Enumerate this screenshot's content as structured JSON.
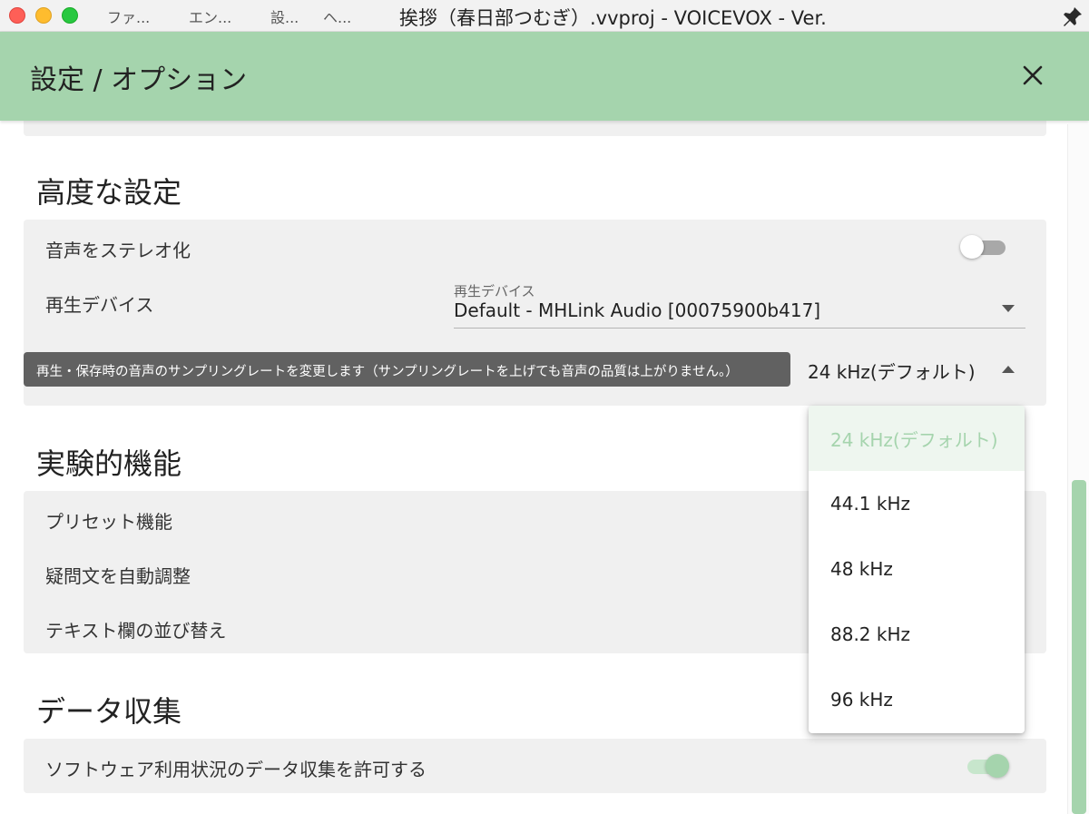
{
  "window": {
    "menus": [
      "ファ...",
      "エン...",
      "設...",
      "ヘ..."
    ],
    "title": "挨拶（春日部つむぎ）.vvproj - VOICEVOX - Ver."
  },
  "dialog": {
    "title": "設定 / オプション"
  },
  "advanced": {
    "title": "高度な設定",
    "stereo": {
      "label": "音声をステレオ化",
      "enabled": false
    },
    "device": {
      "label": "再生デバイス",
      "field_label": "再生デバイス",
      "value": "Default - MHLink Audio [00075900b417]"
    },
    "sampling": {
      "tooltip": "再生・保存時の音声のサンプリングレートを変更します（サンプリングレートを上げても音声の品質は上がりません。）",
      "value": "24 kHz(デフォルト)",
      "options": [
        "24 kHz(デフォルト)",
        "44.1 kHz",
        "48 kHz",
        "88.2 kHz",
        "96 kHz"
      ],
      "selected_index": 0
    }
  },
  "experimental": {
    "title": "実験的機能",
    "items": [
      "プリセット機能",
      "疑問文を自動調整",
      "テキスト欄の並び替え"
    ]
  },
  "data_collection": {
    "title": "データ収集",
    "allow_label": "ソフトウェア利用状況のデータ収集を許可する",
    "enabled": true
  },
  "colors": {
    "accent": "#a5d4ad",
    "card": "#f0f0f0",
    "tooltip": "#616161"
  }
}
